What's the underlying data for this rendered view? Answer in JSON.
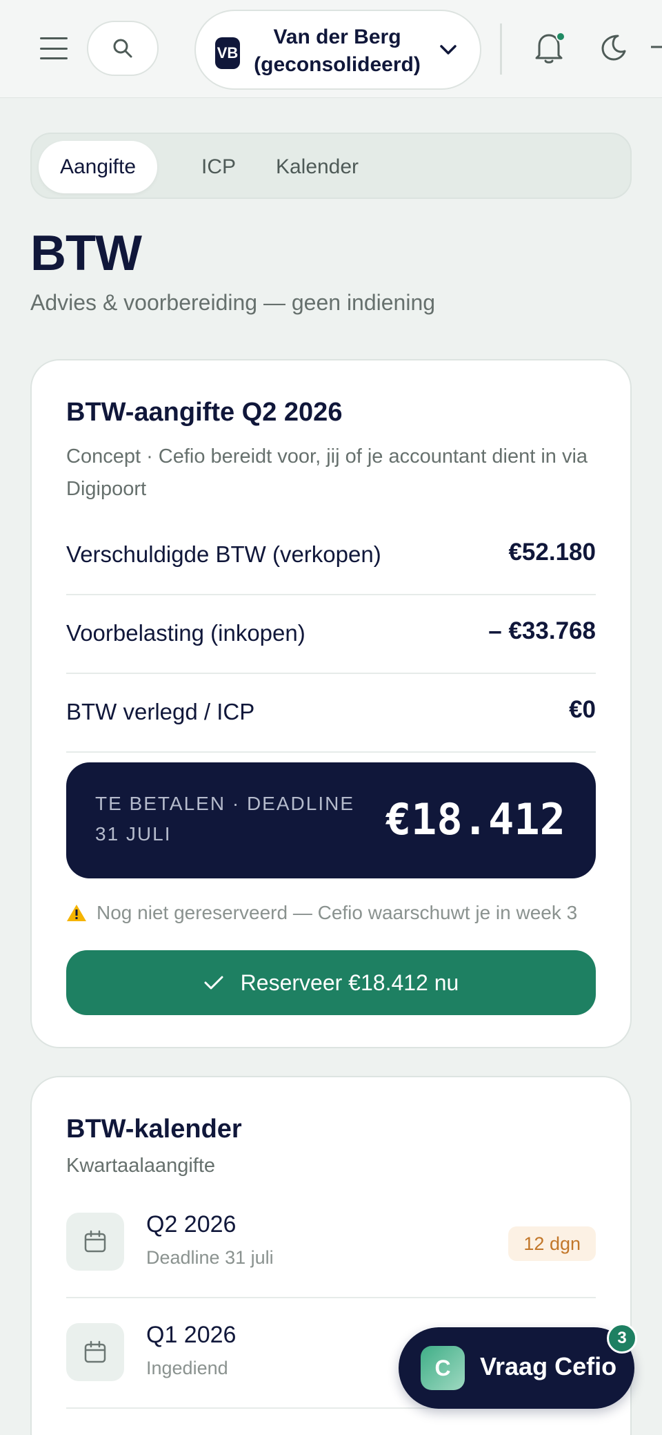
{
  "header": {
    "org_initials": "VB",
    "org_name_line1": "Van der Berg",
    "org_name_line2": "(geconsolideerd)"
  },
  "tabs": [
    {
      "label": "Aangifte",
      "active": true
    },
    {
      "label": "ICP",
      "active": false
    },
    {
      "label": "Kalender",
      "active": false
    }
  ],
  "page": {
    "title": "BTW",
    "subtitle": "Advies & voorbereiding — geen indiening"
  },
  "vat_return": {
    "title": "BTW-aangifte Q2 2026",
    "description": "Concept · Cefio bereidt voor, jij of je accountant dient in via Digipoort",
    "rows": [
      {
        "label": "Verschuldigde BTW (verkopen)",
        "value": "€52.180"
      },
      {
        "label": "Voorbelasting (inkopen)",
        "value": "– €33.768"
      },
      {
        "label": "BTW verlegd / ICP",
        "value": "€0"
      }
    ],
    "payable_label": "TE BETALEN · DEADLINE 31 JULI",
    "payable_amount": "€18.412",
    "warning": "Nog niet gereserveerd — Cefio waarschuwt je in week 3",
    "reserve_button": "Reserveer €18.412 nu"
  },
  "vat_calendar": {
    "title": "BTW-kalender",
    "subtitle": "Kwartaalaangifte",
    "items": [
      {
        "period": "Q2 2026",
        "detail": "Deadline 31 juli",
        "badge": "12 dgn"
      },
      {
        "period": "Q1 2026",
        "detail": "Ingediend",
        "badge": ""
      }
    ]
  },
  "assistant": {
    "logo_letter": "C",
    "label": "Vraag Cefio",
    "count": "3"
  },
  "colors": {
    "navy": "#10173a",
    "green": "#1e8062",
    "warning": "#f5b400",
    "badge_text": "#c2772a",
    "badge_bg": "#fcf1e4"
  }
}
